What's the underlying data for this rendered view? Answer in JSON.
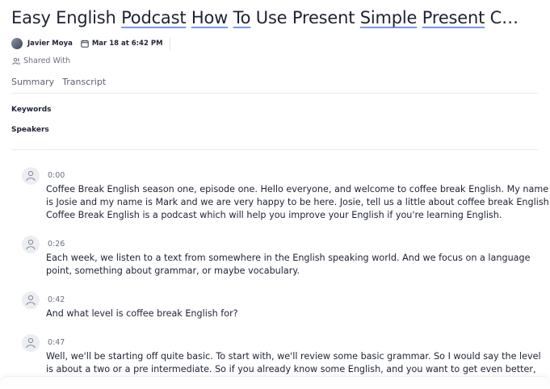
{
  "title": {
    "parts": [
      "Easy English ",
      "Podcast",
      " ",
      "How",
      " ",
      "To",
      " Use Present ",
      "Simple",
      " ",
      "Present",
      " C…"
    ]
  },
  "meta": {
    "author": "Javier Moya",
    "date": "Mar 18 at 6:42 PM",
    "shared_with": "Shared With"
  },
  "tabs": [
    "Summary",
    "Transcript"
  ],
  "sections": {
    "keywords": "Keywords",
    "speakers": "Speakers"
  },
  "transcript": [
    {
      "time": "0:00",
      "text": "Coffee Break English season one, episode one. Hello everyone, and welcome to coffee break English. My name is Josie and my name is Mark and we are very happy to be here. Josie, tell us a little about coffee break English Coffee Break English is a podcast which will help you improve your English if you're learning English."
    },
    {
      "time": "0:26",
      "text": "Each week, we listen to a text from somewhere in the English speaking world. And we focus on a language point, something about grammar, or maybe vocabulary."
    },
    {
      "time": "0:42",
      "text": "And what level is coffee break English for?"
    },
    {
      "time": "0:47",
      "text": "Well, we'll be starting off quite basic. To start with, we'll review some basic grammar. So I would say the level is about a two or a pre intermediate. So if you already know some English, and you want to get even better, this podcast is for you."
    }
  ]
}
